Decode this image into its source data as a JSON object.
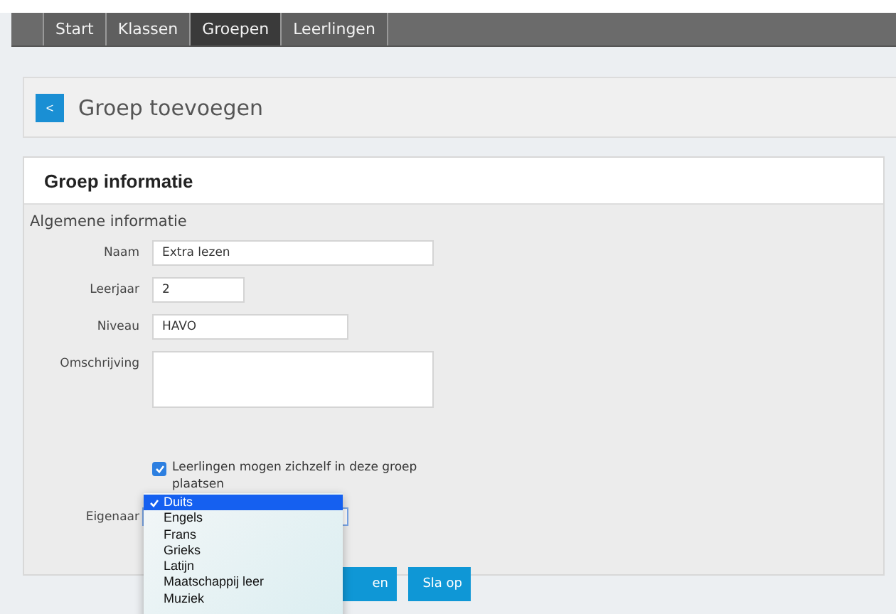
{
  "nav": {
    "tabs": [
      {
        "label": "Start",
        "selected": false
      },
      {
        "label": "Klassen",
        "selected": false
      },
      {
        "label": "Groepen",
        "selected": true
      },
      {
        "label": "Leerlingen",
        "selected": false
      }
    ]
  },
  "page_title": {
    "back_button": "<",
    "title": "Groep toevoegen"
  },
  "panel": {
    "title": "Groep informatie",
    "section": "Algemene informatie",
    "fields": [
      {
        "label": "Naam",
        "value": "Extra lezen",
        "kind": "wide"
      },
      {
        "label": "Leerjaar",
        "value": "2",
        "kind": "short"
      },
      {
        "label": "Niveau",
        "value": "HAVO",
        "kind": "medium"
      },
      {
        "label": "Omschrijving",
        "kind": "textarea"
      }
    ],
    "checkbox": {
      "label": "Leerlingen mogen zichzelf in deze groep plaatsen",
      "checked": true
    },
    "owner": {
      "label": "Eigenaar",
      "options": [
        {
          "label": "Duits",
          "selected": true
        },
        {
          "label": "Engels",
          "selected": false
        },
        {
          "label": "Frans",
          "selected": false
        },
        {
          "label": "Grieks",
          "selected": false
        },
        {
          "label": "Latijn",
          "selected": false
        },
        {
          "label": "Maatschappij leer",
          "selected": false
        },
        {
          "label": "Muziek",
          "selected": false
        }
      ]
    },
    "buttons": [
      "en",
      "Sla op"
    ]
  }
}
